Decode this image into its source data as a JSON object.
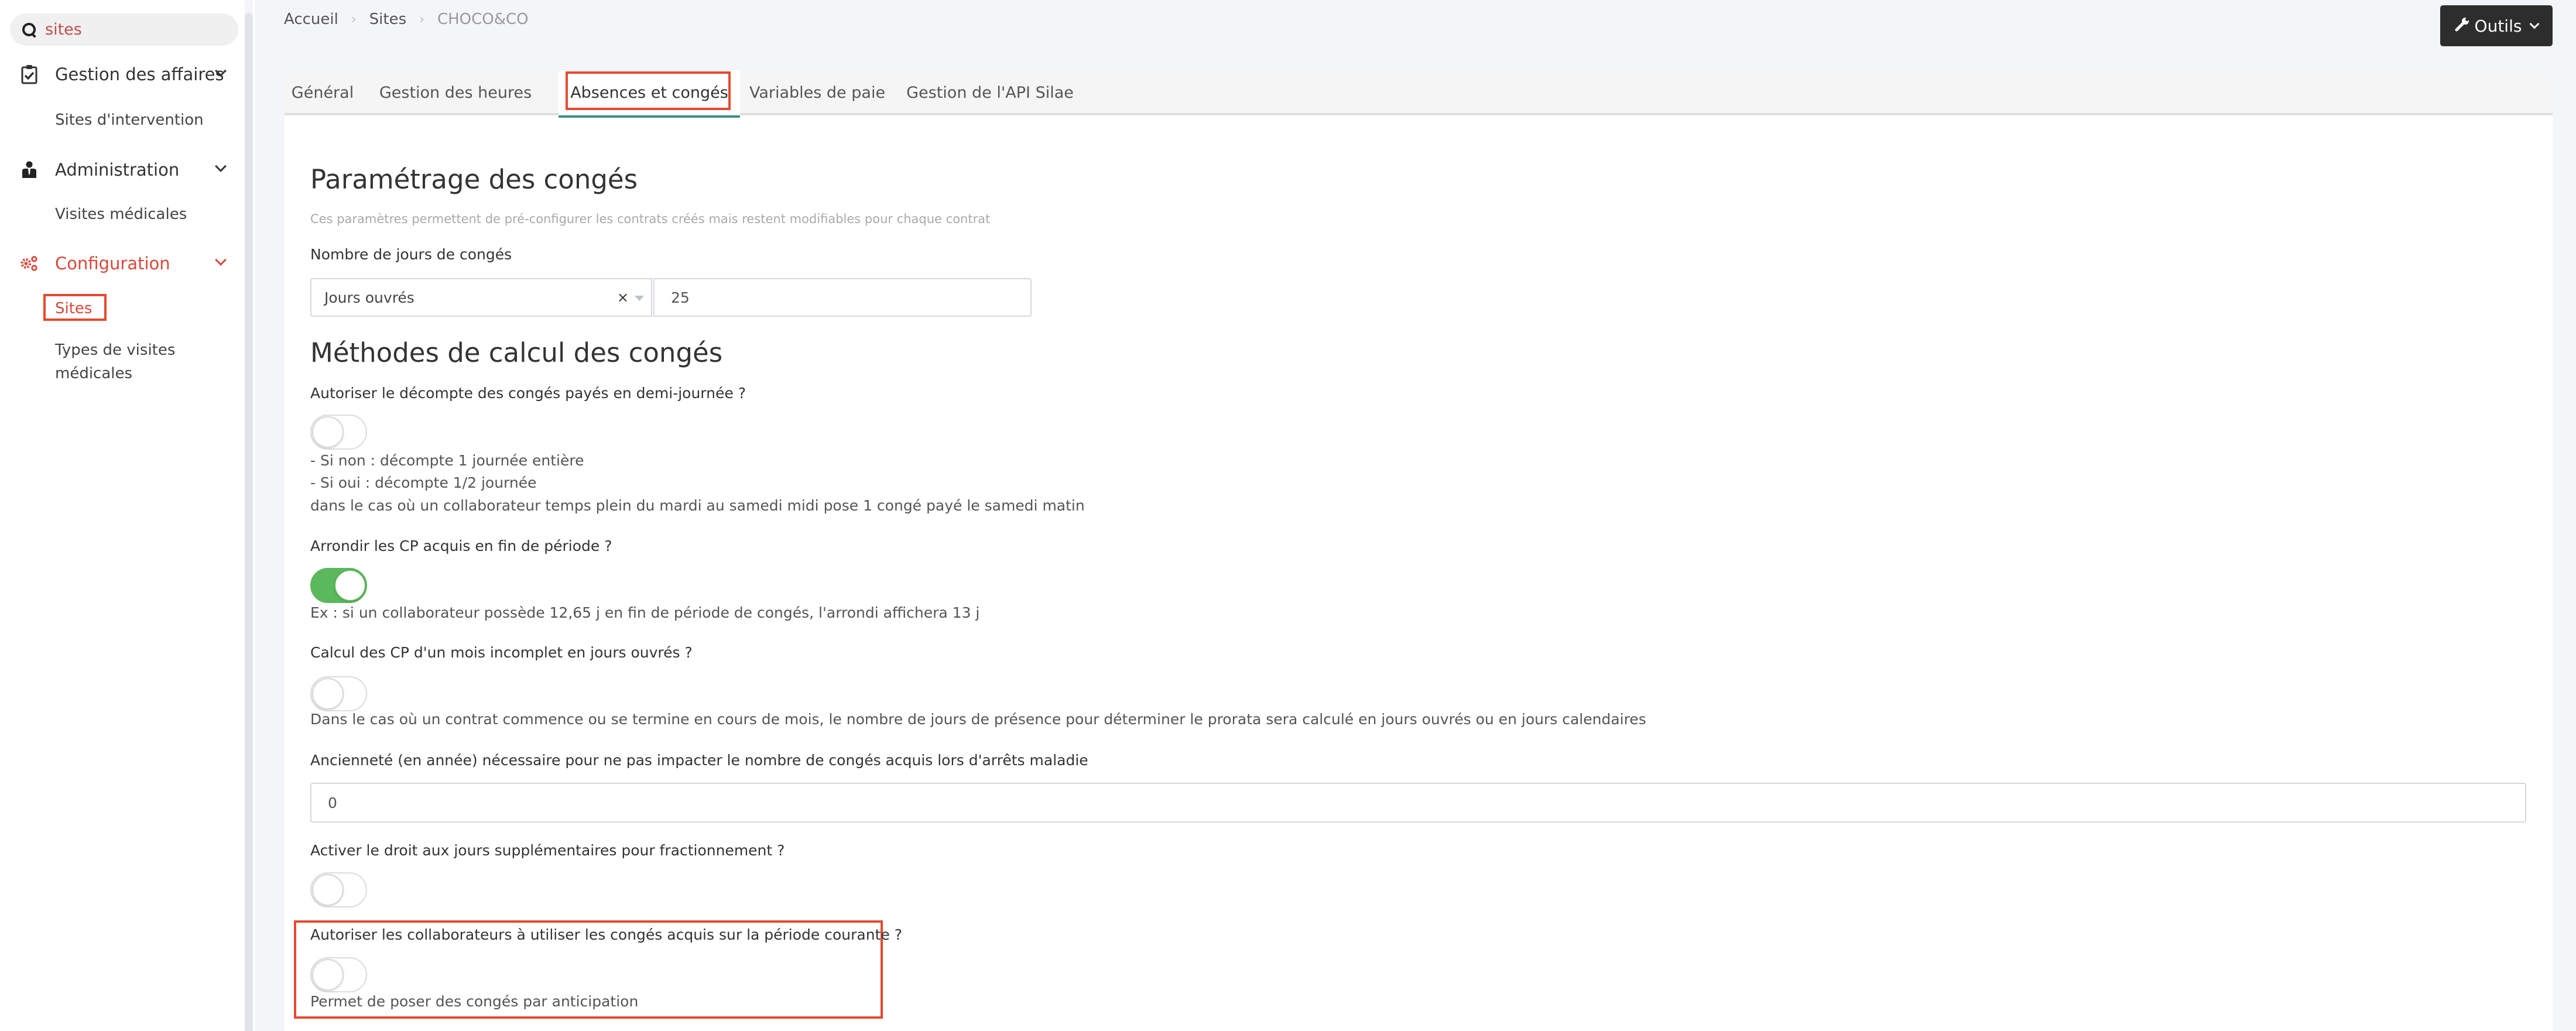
{
  "sidebar": {
    "search": {
      "value": "sites",
      "placeholder": ""
    },
    "groups": [
      {
        "label": "Gestion des affaires",
        "icon": "clipboard-check-icon",
        "items": [
          {
            "label": "Sites d'intervention"
          }
        ]
      },
      {
        "label": "Administration",
        "icon": "user-tie-icon",
        "items": [
          {
            "label": "Visites médicales"
          }
        ]
      },
      {
        "label": "Configuration",
        "icon": "cogs-icon",
        "active": true,
        "items": [
          {
            "label": "Sites",
            "active": true
          },
          {
            "label": "Types de visites médicales"
          }
        ]
      }
    ]
  },
  "breadcrumb": {
    "items": [
      "Accueil",
      "Sites",
      "CHOCO&CO"
    ],
    "separator": "›"
  },
  "toolbar": {
    "tools_label": "Outils",
    "tools_icon": "wrench-icon"
  },
  "tabs": [
    {
      "label": "Général"
    },
    {
      "label": "Gestion des heures"
    },
    {
      "label": "Absences et congés",
      "active": true
    },
    {
      "label": "Variables de paie"
    },
    {
      "label": "Gestion de l'API Silae"
    }
  ],
  "content": {
    "section1": {
      "title": "Paramétrage des congés",
      "subtitle": "Ces paramètres permettent de pré-configurer les contrats créés mais restent modifiables pour chaque contrat",
      "days_label": "Nombre de jours de congés",
      "days_type": {
        "value": "Jours ouvrés",
        "clear": "×"
      },
      "days_count": "25"
    },
    "section2": {
      "title": "Méthodes de calcul des congés",
      "half_day": {
        "label": "Autoriser le décompte des congés payés en demi-journée ?",
        "enabled": false,
        "help": [
          "- Si non : décompte 1 journée entière",
          "- Si oui : décompte 1/2 journée",
          "dans le cas où un collaborateur temps plein du mardi au samedi midi pose 1 congé payé le samedi matin"
        ]
      },
      "round_cp": {
        "label": "Arrondir les CP acquis en fin de période ?",
        "enabled": true,
        "help": "Ex : si un collaborateur possède 12,65 j en fin de période de congés, l'arrondi affichera 13 j"
      },
      "incomplete_month": {
        "label": "Calcul des CP d'un mois incomplet en jours ouvrés ?",
        "enabled": false,
        "help": "Dans le cas où un contrat commence ou se termine en cours de mois, le nombre de jours de présence pour déterminer le prorata sera calculé en jours ouvrés ou en jours calendaires"
      },
      "seniority": {
        "label": "Ancienneté (en année) nécessaire pour ne pas impacter le nombre de congés acquis lors d'arrêts maladie",
        "value": "0"
      },
      "fractionnement": {
        "label": "Activer le droit aux jours supplémentaires pour fractionnement ?",
        "enabled": false
      },
      "current_period": {
        "label": "Autoriser les collaborateurs à utiliser les congés acquis sur la période courante ?",
        "enabled": false,
        "help": "Permet de poser des congés par anticipation"
      }
    }
  },
  "colors": {
    "accent": "#d9483b",
    "highlight": "#e34b2e",
    "toggle_on": "#5cb85c",
    "tab_underline": "#3b8c82",
    "tools_button": "#2d2d2d"
  }
}
